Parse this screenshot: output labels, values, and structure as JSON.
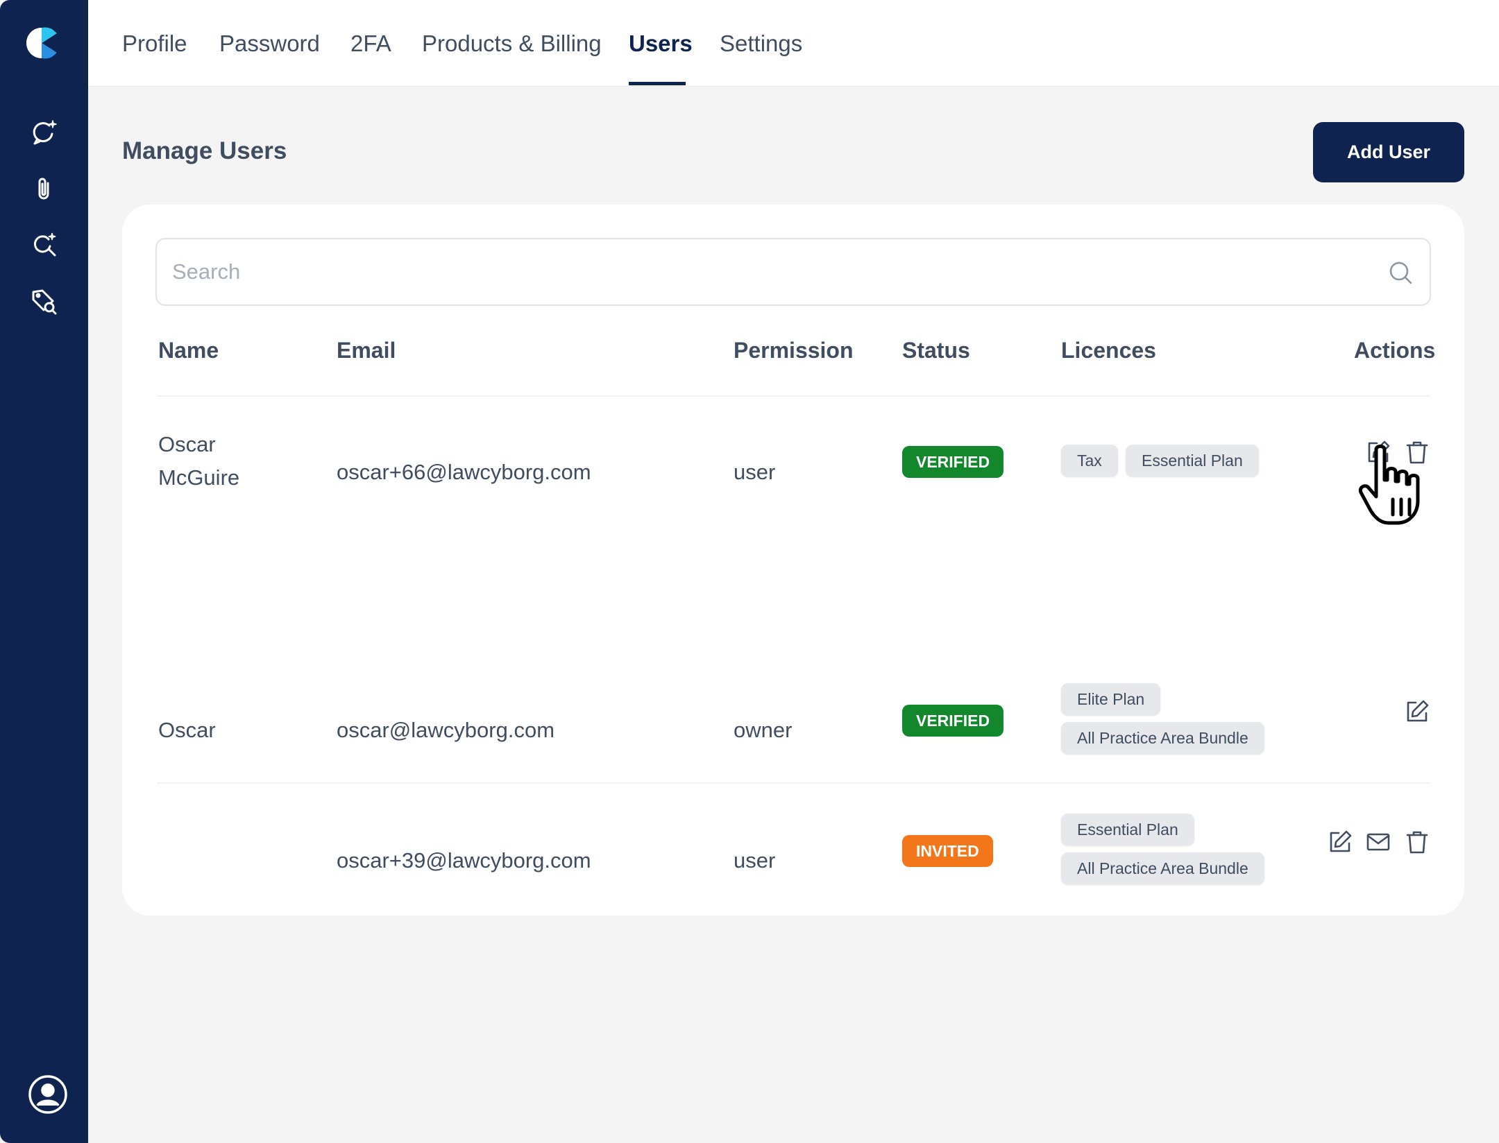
{
  "nav": {
    "tabs": [
      {
        "label": "Profile"
      },
      {
        "label": "Password"
      },
      {
        "label": "2FA"
      },
      {
        "label": "Products & Billing"
      },
      {
        "label": "Users"
      },
      {
        "label": "Settings"
      }
    ],
    "active_tab": "Users"
  },
  "sidebar": {
    "icons": [
      "chat-sparkle-icon",
      "paperclip-icon",
      "search-sparkle-icon",
      "tag-search-icon"
    ],
    "account_icon": "user-circle-icon"
  },
  "header": {
    "title": "Manage Users",
    "add_button": "Add User"
  },
  "search": {
    "placeholder": "Search",
    "value": ""
  },
  "table": {
    "columns": {
      "name": "Name",
      "email": "Email",
      "permission": "Permission",
      "status": "Status",
      "licences": "Licences",
      "actions": "Actions"
    },
    "rows": [
      {
        "name": "Oscar McGuire",
        "email": "oscar+66@lawcyborg.com",
        "permission": "user",
        "status": "VERIFIED",
        "licences": [
          "Tax",
          "Essential Plan"
        ],
        "actions": [
          "edit",
          "delete"
        ]
      },
      {
        "name": "Oscar",
        "email": "oscar@lawcyborg.com",
        "permission": "owner",
        "status": "VERIFIED",
        "licences": [
          "Elite Plan",
          "All Practice Area Bundle"
        ],
        "actions": [
          "edit"
        ]
      },
      {
        "name": "",
        "email": "oscar+39@lawcyborg.com",
        "permission": "user",
        "status": "INVITED",
        "licences": [
          "Essential Plan",
          "All Practice Area Bundle"
        ],
        "actions": [
          "edit",
          "resend-invite",
          "delete"
        ]
      }
    ]
  },
  "colors": {
    "sidebar": "#0f2350",
    "primary": "#0f2350",
    "verified": "#12872b",
    "invited": "#f4761b",
    "chip": "#e7e8eb"
  }
}
